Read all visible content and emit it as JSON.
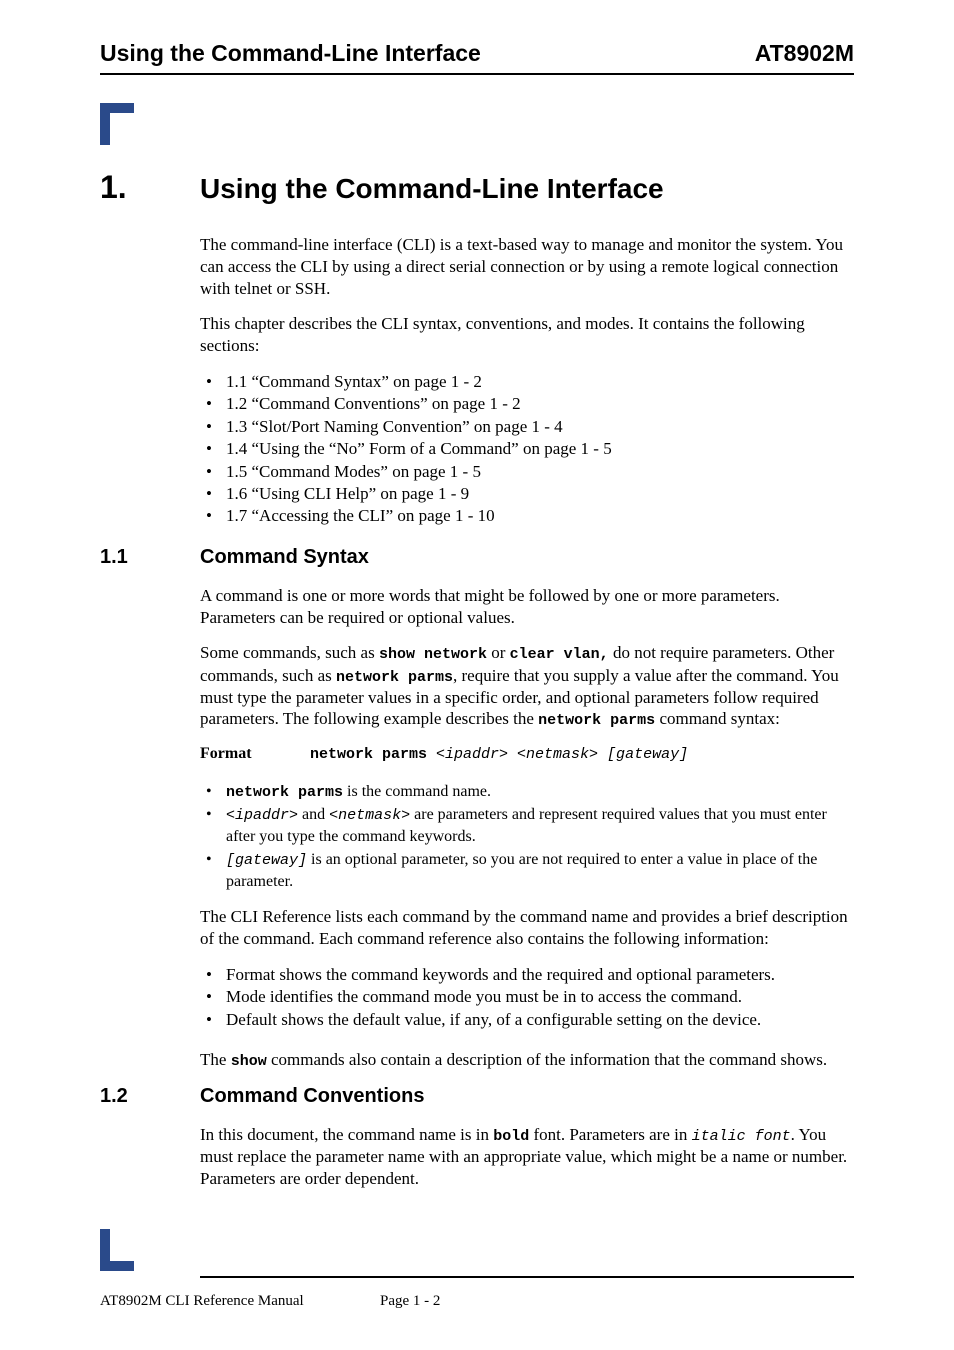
{
  "header": {
    "left": "Using the Command-Line Interface",
    "right": "AT8902M"
  },
  "chapter": {
    "num": "1.",
    "title": "Using the Command-Line Interface",
    "para1": "The command-line interface (CLI) is a text-based way to manage and monitor the system. You can access the CLI by using a direct serial connection or by using a remote logical connection with telnet or SSH.",
    "para2": "This chapter describes the CLI syntax, conventions, and modes. It contains the following sections:",
    "toc": [
      "1.1 “Command Syntax” on page 1 - 2",
      "1.2 “Command Conventions” on page 1 - 2",
      "1.3 “Slot/Port Naming Convention” on page 1 - 4",
      "1.4 “Using the “No” Form of a Command” on page 1 - 5",
      "1.5 “Command Modes” on page 1 - 5",
      "1.6 “Using CLI Help” on page 1 - 9",
      "1.7 “Accessing the CLI” on page 1 - 10"
    ]
  },
  "s11": {
    "num": "1.1",
    "title": "Command Syntax",
    "p1": "A command is one or more words that might be followed by one or more parameters. Parameters can be required or optional values.",
    "p2a": "Some commands, such as ",
    "p2_cmd1": "show network",
    "p2b": " or ",
    "p2_cmd2": "clear vlan,",
    "p2c": " do not require parameters. Other commands, such as ",
    "p2_cmd3": "network parms",
    "p2d": ", require that you supply a value after the command. You must type the parameter values in a specific order, and optional parameters follow required parameters. The following example describes the ",
    "p2_cmd4": "network parms",
    "p2e": " command syntax:",
    "format_label": "Format",
    "format_cmd": "network parms",
    "format_args": " <ipaddr> <netmask> [gateway]",
    "b1_cmd": "network parms",
    "b1_txt": " is the command name.",
    "b2_a": "<ipaddr>",
    "b2_mid": " and ",
    "b2_b": "<netmask>",
    "b2_txt": " are parameters and represent required values that you must enter after you type the command keywords.",
    "b3_a": "[gateway]",
    "b3_txt": "  is an optional parameter, so you are not required to enter a value in place of the parameter.",
    "p3": "The CLI Reference lists each command by the command name and provides a brief description of the command. Each command reference also contains the following information:",
    "b4": "Format shows the command keywords and the required and optional parameters.",
    "b5": "Mode identifies the command mode you must be in to access the command.",
    "b6": "Default shows the default value, if any, of a configurable setting on the device.",
    "p4a": "The ",
    "p4_cmd": "show",
    "p4b": " commands also contain a description of the information that the command shows."
  },
  "s12": {
    "num": "1.2",
    "title": "Command Conventions",
    "p1a": "In this document, the command name is in ",
    "p1_bold": "bold",
    "p1b": " font. Parameters are in ",
    "p1_italic": "italic font",
    "p1c": ". You must replace the parameter name with an appropriate value, which might be a name or number. Parameters are order dependent."
  },
  "footer": {
    "left": "AT8902M CLI Reference Manual",
    "center": "Page 1 - 2"
  }
}
